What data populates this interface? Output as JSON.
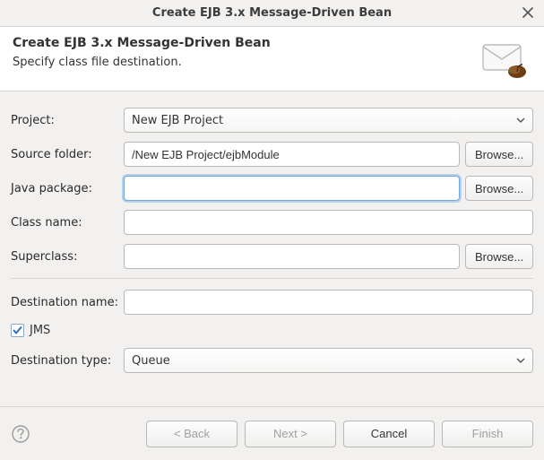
{
  "window": {
    "title": "Create EJB 3.x Message-Driven Bean"
  },
  "banner": {
    "heading": "Create EJB 3.x Message-Driven Bean",
    "subheading": "Specify class file destination."
  },
  "form": {
    "project_label": "Project:",
    "project_value": "New EJB Project",
    "source_folder_label": "Source folder:",
    "source_folder_value": "/New EJB Project/ejbModule",
    "java_package_label": "Java package:",
    "java_package_value": "",
    "class_name_label": "Class name:",
    "class_name_value": "",
    "superclass_label": "Superclass:",
    "superclass_value": "",
    "destination_name_label": "Destination name:",
    "destination_name_value": "",
    "jms_label": "JMS",
    "jms_checked": true,
    "destination_type_label": "Destination type:",
    "destination_type_value": "Queue",
    "browse_label": "Browse..."
  },
  "buttons": {
    "back": "< Back",
    "next": "Next >",
    "cancel": "Cancel",
    "finish": "Finish"
  }
}
